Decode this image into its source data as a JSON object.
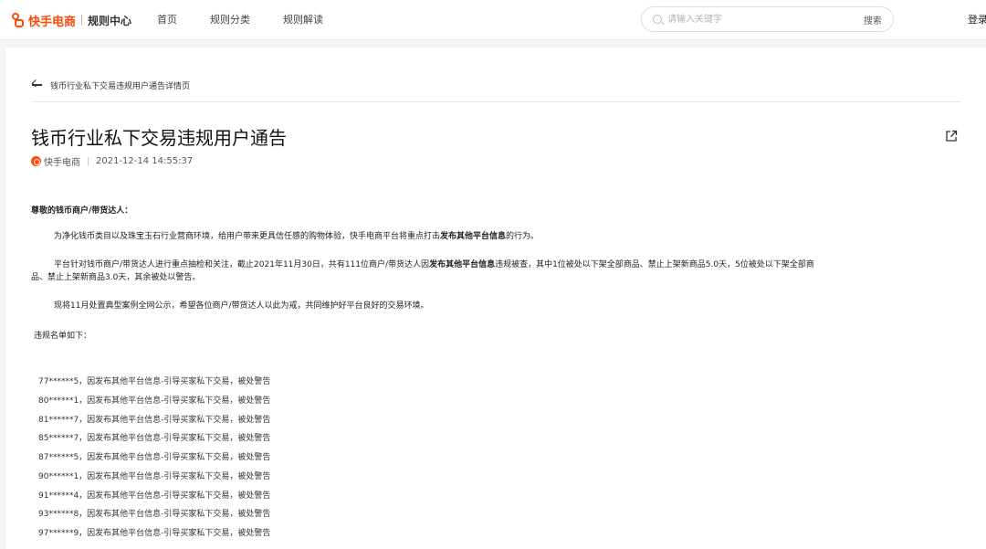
{
  "header": {
    "brand": "快手电商",
    "subtitle": "规则中心",
    "nav": [
      "首页",
      "规则分类",
      "规则解读"
    ],
    "search": {
      "placeholder": "请输入关键字",
      "button": "搜索"
    },
    "login": "登录"
  },
  "breadcrumb": {
    "label": "钱币行业私下交易违规用户通告详情页"
  },
  "article": {
    "title": "钱币行业私下交易违规用户通告",
    "author": "快手电商",
    "date": "2021-12-14 14:55:37",
    "greeting": "尊敬的钱币商户/带货达人：",
    "p1": {
      "pre": "为净化钱币类目以及珠宝玉石行业营商环境，给用户带来更具信任感的购物体验，快手电商平台将重点打击",
      "bold": "发布其他平台信息",
      "post": "的行为。"
    },
    "p2": {
      "pre": "平台针对钱币商户/带货达人进行重点抽检和关注，截止2021年11月30日，共有111位商户/带货达人因",
      "bold": "发布其他平台信息",
      "line1_post": "违规被查，其中1位被处以下架全部商品、禁止上架新商品5.0天，5位被处以下架全部商",
      "line2": "品、禁止上架新商品3.0天，其余被处以警告。"
    },
    "p3": "现将11月处置典型案例全网公示，希望各位商户/带货达人以此为戒，共同维护好平台良好的交易环境。",
    "list_heading": "违规名单如下：",
    "violations": [
      "77******5，因发布其他平台信息-引导买家私下交易，被处警告",
      "80******1，因发布其他平台信息-引导买家私下交易，被处警告",
      "81******7，因发布其他平台信息-引导买家私下交易，被处警告",
      "85******7，因发布其他平台信息-引导买家私下交易，被处警告",
      "87******5，因发布其他平台信息-引导买家私下交易，被处警告",
      "90******1，因发布其他平台信息-引导买家私下交易，被处警告",
      "91******4，因发布其他平台信息-引导买家私下交易，被处警告",
      "93******8，因发布其他平台信息-引导买家私下交易，被处警告",
      "97******9，因发布其他平台信息-引导买家私下交易，被处警告"
    ]
  },
  "colors": {
    "brand": "#ff4906"
  }
}
